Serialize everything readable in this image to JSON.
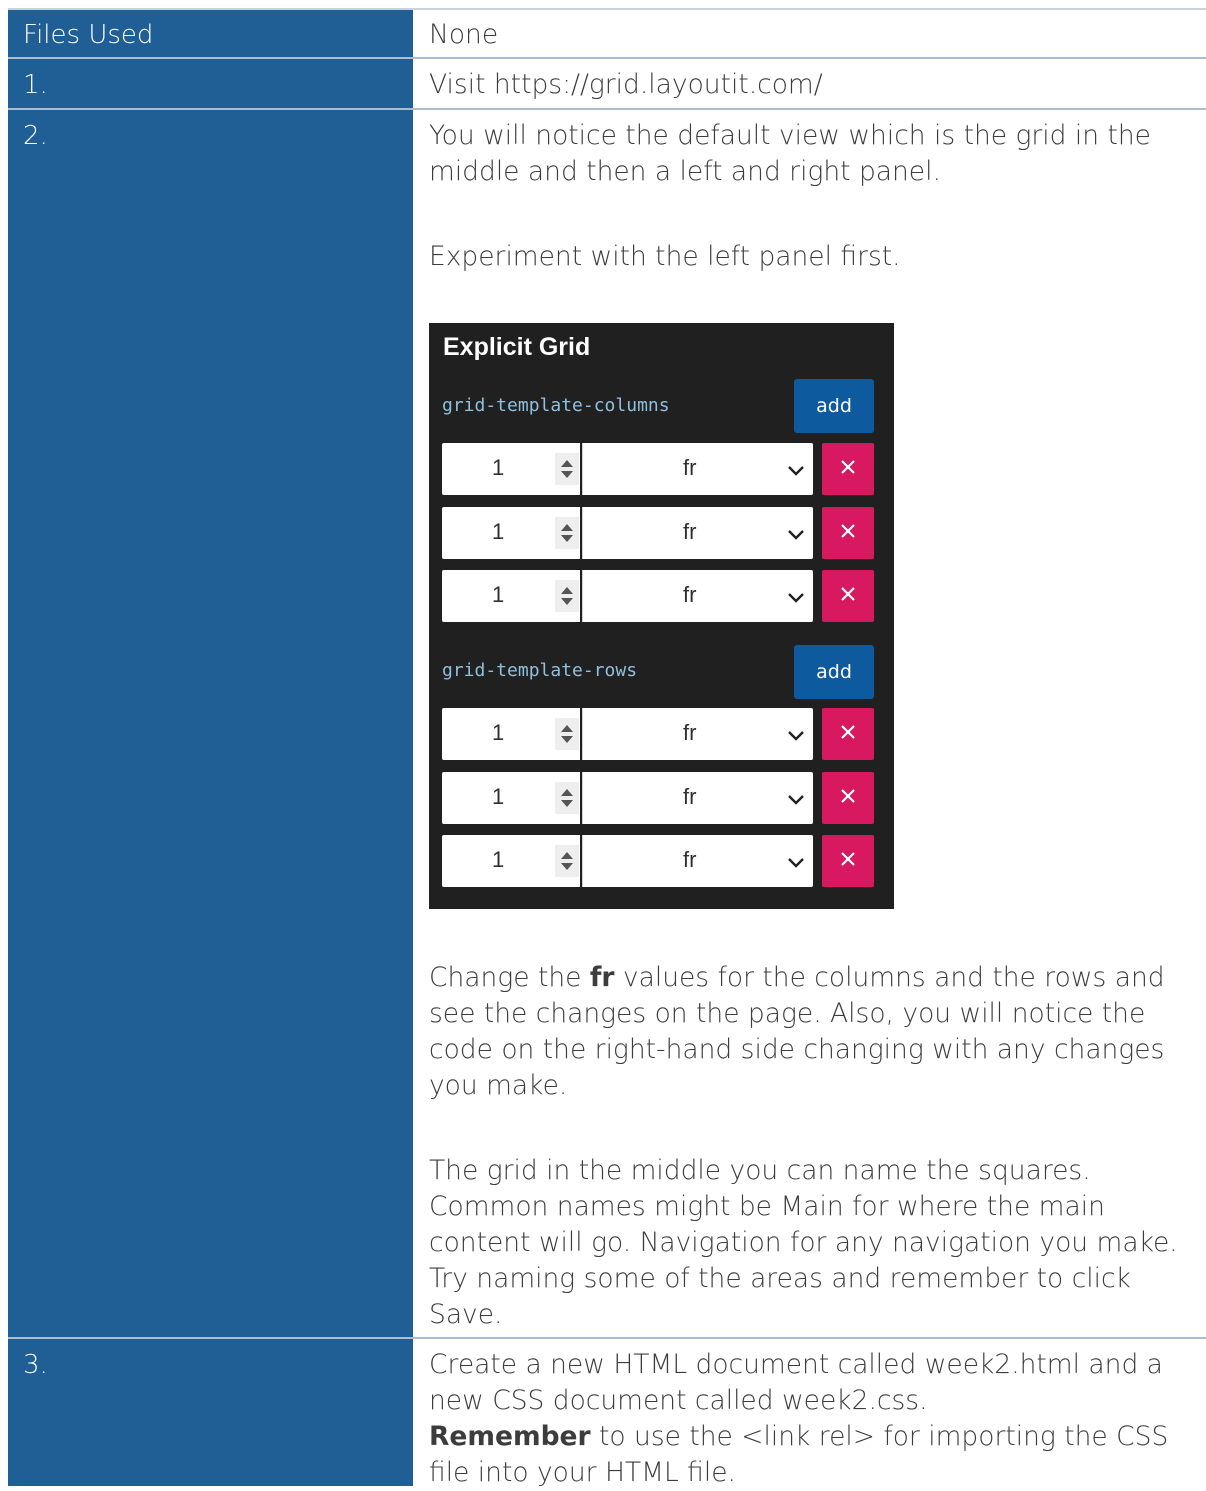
{
  "table": {
    "header_label": "Files Used",
    "header_value": "None",
    "steps": [
      {
        "label": "1.",
        "text": "Visit https://grid.layoutit.com/"
      },
      {
        "label": "2.",
        "p1": "You will notice the default view which is the grid in the middle and then a left and right panel.",
        "p2": "Experiment with the left panel first.",
        "p3_before": "Change the ",
        "p3_bold": "fr",
        "p3_after": " values for the columns and the rows and see the changes on the page. Also, you will notice the code on the right-hand side changing with any changes you make.",
        "p4": "The grid in the middle you can name the squares. Common names might be Main for where the main content will go. Navigation for any navigation you make. Try naming some of the areas and remember to click Save."
      },
      {
        "label": "3.",
        "p1": "Create a new HTML document called week2.html and a new CSS document called week2.css.",
        "p2_bold": "Remember",
        "p2_after": " to use the <link rel> for importing the CSS file into your HTML file."
      }
    ]
  },
  "panel": {
    "title": "Explicit Grid",
    "columns_label": "grid-template-columns",
    "rows_label": "grid-template-rows",
    "add_label": "add",
    "columns": [
      {
        "value": "1",
        "unit": "fr"
      },
      {
        "value": "1",
        "unit": "fr"
      },
      {
        "value": "1",
        "unit": "fr"
      }
    ],
    "rows": [
      {
        "value": "1",
        "unit": "fr"
      },
      {
        "value": "1",
        "unit": "fr"
      },
      {
        "value": "1",
        "unit": "fr"
      }
    ],
    "icons": {
      "spinner": "spinner-icon",
      "dropdown": "chevron-down-icon",
      "remove": "close-icon"
    },
    "colors": {
      "panel_bg": "#202020",
      "add_bg": "#0d5a9e",
      "remove_bg": "#d8195f",
      "label": "#8fc0de"
    }
  },
  "colors": {
    "label_column": "#1f5f95",
    "text": "#3c3c3c"
  }
}
